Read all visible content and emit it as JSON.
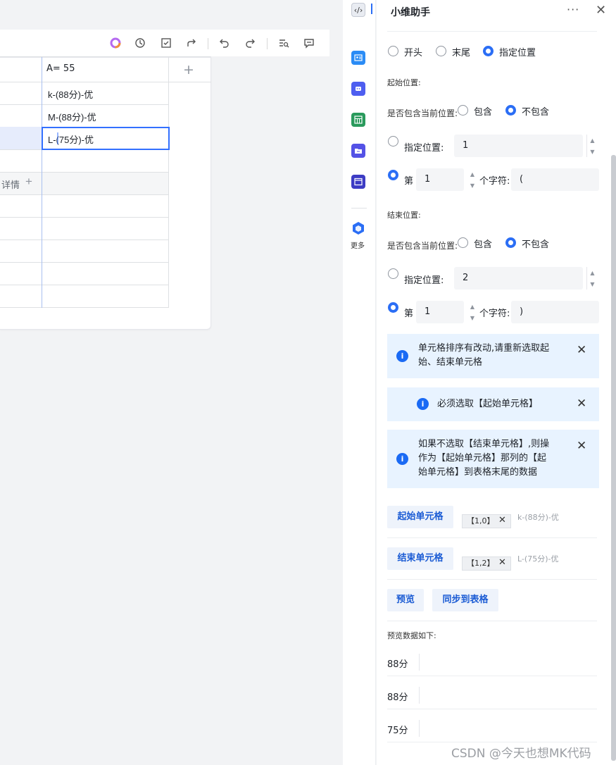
{
  "toolbar": {
    "icons": [
      "ai-icon",
      "history-icon",
      "checkbox-icon",
      "share-icon",
      "undo-icon",
      "redo-icon",
      "find-icon",
      "comment-icon"
    ]
  },
  "sheet": {
    "column_header": "A= 55",
    "rows": [
      "k-(88分)-优",
      "M-(88分)-优",
      "L-(75分)-优"
    ],
    "left_row_label": "详情"
  },
  "side_strip": {
    "more_label": "更多"
  },
  "panel": {
    "title": "小维助手",
    "more": "···",
    "close": "✕",
    "mode_options": [
      "开头",
      "末尾",
      "指定位置"
    ],
    "start": {
      "section_label": "起始位置:",
      "include_label": "是否包含当前位置:",
      "include_yes": "包含",
      "include_no": "不包含",
      "pos_label": "指定位置:",
      "pos_value": "1",
      "nth_prefix": "第",
      "nth_value": "1",
      "nth_suffix": "个字符:",
      "char_value": "("
    },
    "end": {
      "section_label": "结束位置:",
      "include_label": "是否包含当前位置:",
      "include_yes": "包含",
      "include_no": "不包含",
      "pos_label": "指定位置:",
      "pos_value": "2",
      "nth_prefix": "第",
      "nth_value": "1",
      "nth_suffix": "个字符:",
      "char_value": ")"
    },
    "alerts": [
      {
        "line1": "单元格排序有改动,请重新选取起",
        "line2": "始、结束单元格"
      },
      {
        "line1": "必须选取【起始单元格】"
      },
      {
        "line1": "如果不选取【结束单元格】,则操",
        "line2": "作为【起始单元格】那列的【起",
        "line3": "始单元格】到表格末尾的数据"
      }
    ],
    "start_cell_btn": "起始单元格",
    "start_cell_tag": "【1,0】",
    "start_cell_value": "k-(88分)-优",
    "end_cell_btn": "结束单元格",
    "end_cell_tag": "【1,2】",
    "end_cell_value": "L-(75分)-优",
    "preview_btn": "预览",
    "sync_btn": "同步到表格",
    "preview_title": "预览数据如下:",
    "preview_values": [
      "88分",
      "88分",
      "75分"
    ]
  },
  "watermark": "CSDN @今天也想MK代码"
}
